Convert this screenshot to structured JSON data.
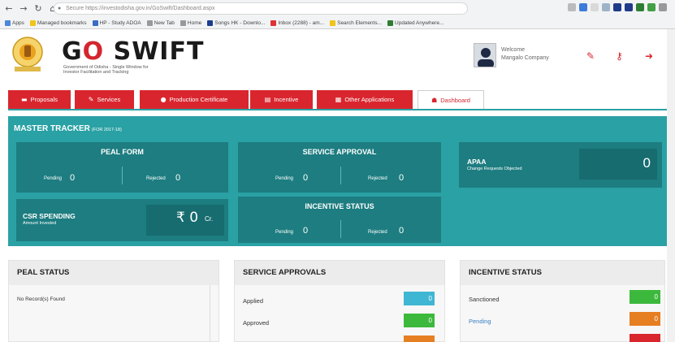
{
  "browser": {
    "url": "Secure  https://investodisha.gov.in/GoSwift/Dashboard.aspx",
    "bookmarks": [
      "Apps",
      "Managed bookmarks",
      "HP - Study ADOA",
      "New Tab",
      "Home",
      "Songs HK - Downlo...",
      "Inbox (2288) - am...",
      "Search Elements...",
      "Updated Anywhere..."
    ]
  },
  "header": {
    "logo_pre": "G",
    "logo_o": "O",
    "logo_post": " SWIFT",
    "tagline": "Government of Odisha - Single Window for Investor Facilitation and Tracking",
    "welcome": "Welcome",
    "company": "Mangalo Company",
    "icons": [
      "edit-icon",
      "key-icon",
      "logout-icon"
    ]
  },
  "tabs": [
    {
      "label": "Proposals",
      "icon": "▬"
    },
    {
      "label": "Services",
      "icon": "✎"
    },
    {
      "label": "Production Certificate",
      "icon": "●"
    },
    {
      "label": "Incentive",
      "icon": "▤"
    },
    {
      "label": "Other Applications",
      "icon": "▦"
    },
    {
      "label": "Dashboard",
      "icon": "☗"
    }
  ],
  "tracker": {
    "title": "MASTER TRACKER",
    "subtitle": "(FOR 2017-18)",
    "peal": {
      "title": "PEAL FORM",
      "pending_label": "Pending",
      "pending": "0",
      "rejected_label": "Rejected",
      "rejected": "0"
    },
    "service": {
      "title": "SERVICE APPROVAL",
      "pending_label": "Pending",
      "pending": "0",
      "rejected_label": "Rejected",
      "rejected": "0"
    },
    "apaa": {
      "title": "APAA",
      "subtitle": "Change Requests Objected",
      "value": "0"
    },
    "csr": {
      "title": "CSR SPENDING",
      "subtitle": "Amount Invested",
      "value": "₹ 0",
      "unit": "Cr."
    },
    "incentive": {
      "title": "INCENTIVE STATUS",
      "pending_label": "Pending",
      "pending": "0",
      "rejected_label": "Rejected",
      "rejected": "0"
    }
  },
  "panels": {
    "peal": {
      "title": "PEAL STATUS",
      "empty": "No Record(s) Found"
    },
    "service": {
      "title": "SERVICE APPROVALS",
      "rows": [
        {
          "label": "Applied",
          "value": "0",
          "color": "#3fb6d3"
        },
        {
          "label": "Approved",
          "value": "0",
          "color": "#3cb93c"
        }
      ]
    },
    "incentive": {
      "title": "INCENTIVE STATUS",
      "rows": [
        {
          "label": "Sanctioned",
          "value": "0",
          "color": "#3cb93c"
        },
        {
          "label": "Pending",
          "value": "0",
          "color": "#e67e22"
        }
      ]
    }
  }
}
